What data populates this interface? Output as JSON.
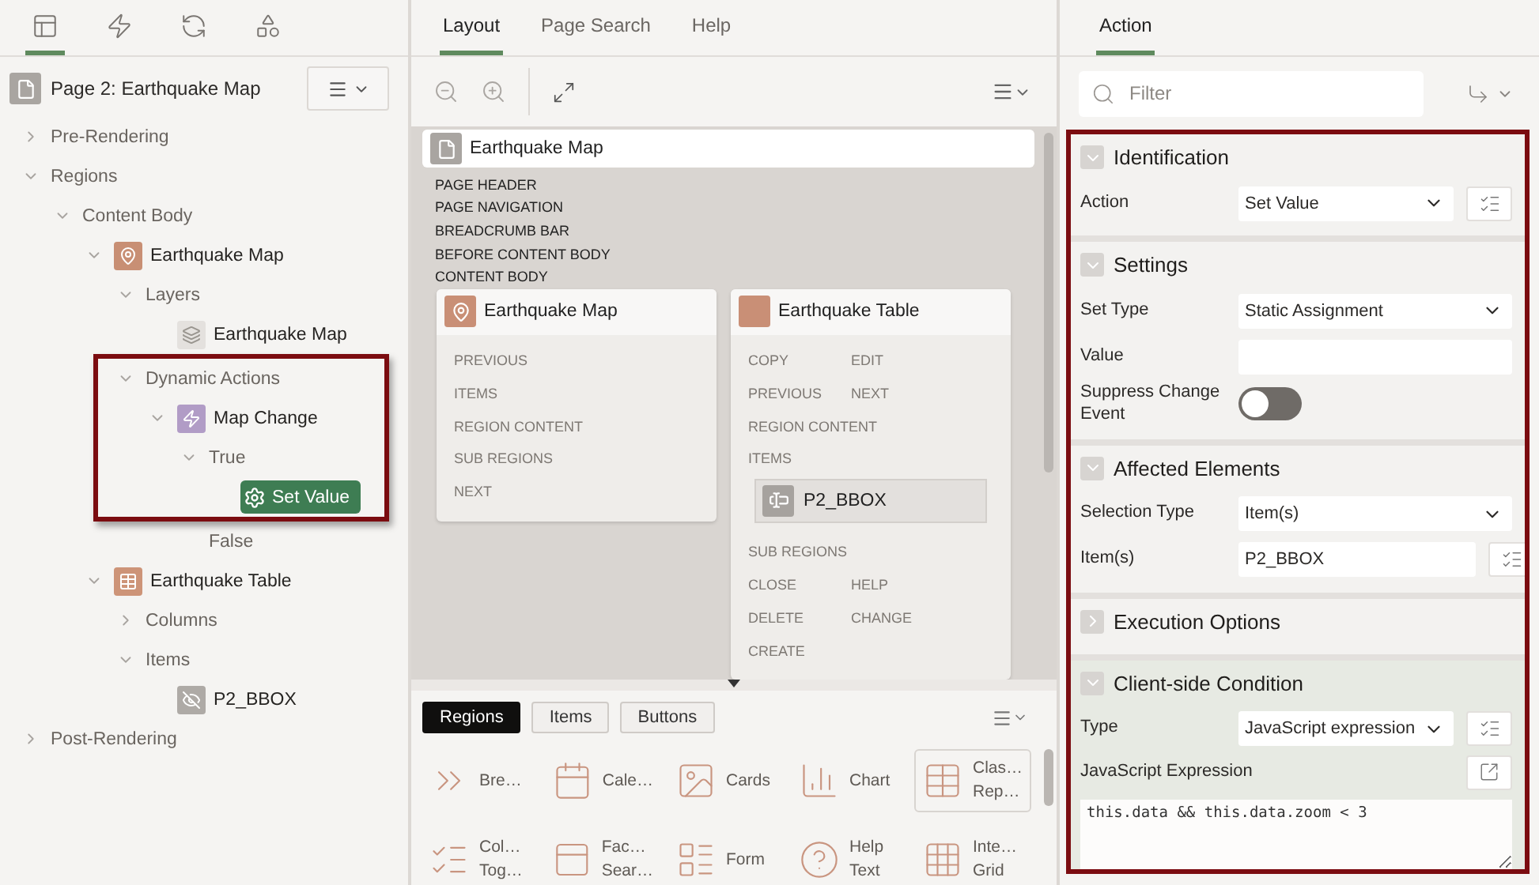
{
  "navigator": {
    "tabs": [
      {
        "kind": "rendering",
        "selected": true
      },
      {
        "kind": "dynamic",
        "selected": false
      },
      {
        "kind": "processing",
        "selected": false
      },
      {
        "kind": "shared",
        "selected": false
      }
    ],
    "page_title": "Page 2: Earthquake Map",
    "tree": [
      {
        "label": "Pre-Rendering",
        "expanded": false,
        "selected": false,
        "framed": false
      },
      {
        "label": "Regions",
        "expanded": true,
        "selected": false,
        "framed": false,
        "children": [
          {
            "label": "Content Body",
            "expanded": true,
            "selected": false,
            "framed": false,
            "children": [
              {
                "label": "Earthquake Map",
                "kind": "map",
                "expanded": true,
                "selected": false,
                "framed": false,
                "children": [
                  {
                    "label": "Layers",
                    "expanded": true,
                    "selected": false,
                    "framed": false,
                    "children": [
                      {
                        "label": "Earthquake Map",
                        "kind": "layer",
                        "selected": false,
                        "framed": false
                      }
                    ]
                  },
                  {
                    "label": "Dynamic Actions",
                    "expanded": true,
                    "selected": false,
                    "framed": true,
                    "children": [
                      {
                        "label": "Map Change",
                        "kind": "event",
                        "expanded": true,
                        "selected": false,
                        "framed": true,
                        "children": [
                          {
                            "label": "True",
                            "expanded": true,
                            "selected": false,
                            "framed": true,
                            "children": [
                              {
                                "label": "Set Value",
                                "kind": "action",
                                "selected": true,
                                "framed": true
                              }
                            ]
                          },
                          {
                            "label": "False",
                            "selected": false,
                            "framed": false
                          }
                        ]
                      }
                    ]
                  }
                ]
              },
              {
                "label": "Earthquake Table",
                "kind": "table",
                "expanded": true,
                "selected": false,
                "framed": false,
                "children": [
                  {
                    "label": "Columns",
                    "expanded": false,
                    "selected": false,
                    "framed": false
                  },
                  {
                    "label": "Items",
                    "expanded": true,
                    "selected": false,
                    "framed": false,
                    "children": [
                      {
                        "label": "P2_BBOX",
                        "kind": "hidden",
                        "selected": false,
                        "framed": false
                      }
                    ]
                  }
                ]
              }
            ]
          }
        ]
      },
      {
        "label": "Post-Rendering",
        "expanded": false,
        "selected": false,
        "framed": false
      }
    ]
  },
  "layout": {
    "tabs": [
      {
        "label": "Layout",
        "selected": true
      },
      {
        "label": "Page Search",
        "selected": false
      },
      {
        "label": "Help",
        "selected": false
      }
    ],
    "page": {
      "title": "Earthquake Map"
    },
    "positions": [
      "PAGE HEADER",
      "PAGE NAVIGATION",
      "BREADCRUMB BAR",
      "BEFORE CONTENT BODY",
      "CONTENT BODY"
    ],
    "regions": [
      {
        "title": "Earthquake Map",
        "kind": "map",
        "slots": [
          {
            "kind": "slot",
            "labels": [
              "PREVIOUS"
            ]
          },
          {
            "kind": "slot",
            "labels": [
              "ITEMS"
            ]
          },
          {
            "kind": "slot",
            "labels": [
              "REGION CONTENT"
            ]
          },
          {
            "kind": "slot",
            "labels": [
              "SUB REGIONS"
            ]
          },
          {
            "kind": "slot",
            "labels": [
              "NEXT"
            ]
          }
        ]
      },
      {
        "title": "Earthquake Table",
        "kind": "plain",
        "slots": [
          {
            "kind": "slot",
            "labels": [
              "COPY",
              "EDIT"
            ]
          },
          {
            "kind": "slot",
            "labels": [
              "PREVIOUS",
              "NEXT"
            ]
          },
          {
            "kind": "slot",
            "labels": [
              "REGION CONTENT"
            ]
          },
          {
            "kind": "slot",
            "labels": [
              "ITEMS"
            ]
          },
          {
            "kind": "item",
            "label": "P2_BBOX"
          },
          {
            "kind": "slot",
            "labels": [
              "SUB REGIONS"
            ]
          },
          {
            "kind": "slot",
            "labels": [
              "CLOSE",
              "HELP"
            ]
          },
          {
            "kind": "slot",
            "labels": [
              "DELETE",
              "CHANGE"
            ]
          },
          {
            "kind": "slot",
            "labels": [
              "CREATE"
            ]
          }
        ]
      }
    ]
  },
  "gallery": {
    "tabs": [
      {
        "label": "Regions",
        "selected": true
      },
      {
        "label": "Items",
        "selected": false
      },
      {
        "label": "Buttons",
        "selected": false
      }
    ],
    "items": [
      {
        "kind": "breadcrumb",
        "lines": [
          "Bre…"
        ],
        "selected": false
      },
      {
        "kind": "calendar",
        "lines": [
          "Cale…"
        ],
        "selected": false
      },
      {
        "kind": "cards",
        "lines": [
          "Cards"
        ],
        "selected": false
      },
      {
        "kind": "chart",
        "lines": [
          "Chart"
        ],
        "selected": false
      },
      {
        "kind": "report",
        "lines": [
          "Clas…",
          "Rep…"
        ],
        "selected": true
      },
      {
        "kind": "toggle",
        "lines": [
          "Col…",
          "Tog…"
        ],
        "selected": false
      },
      {
        "kind": "search",
        "lines": [
          "Fac…",
          "Sear…"
        ],
        "selected": false
      },
      {
        "kind": "form",
        "lines": [
          "Form"
        ],
        "selected": false
      },
      {
        "kind": "help",
        "lines": [
          "Help",
          "Text"
        ],
        "selected": false
      },
      {
        "kind": "grid",
        "lines": [
          "Inte…",
          "Grid"
        ],
        "selected": false
      }
    ]
  },
  "property_editor": {
    "tabs": [
      {
        "label": "Action",
        "selected": true
      }
    ],
    "filter": {
      "placeholder": "Filter"
    },
    "framed": true,
    "sections": [
      {
        "title": "Identification",
        "expanded": true,
        "active": false,
        "properties": [
          {
            "kind": "select",
            "label": "Action",
            "value": "Set Value",
            "picker": true
          }
        ]
      },
      {
        "title": "Settings",
        "expanded": true,
        "active": false,
        "properties": [
          {
            "kind": "select",
            "label": "Set Type",
            "value": "Static Assignment",
            "picker": false
          },
          {
            "kind": "text",
            "label": "Value",
            "picker": false
          },
          {
            "kind": "switch",
            "label": "Suppress Change Event",
            "on": false
          }
        ]
      },
      {
        "title": "Affected Elements",
        "expanded": true,
        "active": false,
        "properties": [
          {
            "kind": "select",
            "label": "Selection Type",
            "value": "Item(s)",
            "picker": false
          },
          {
            "kind": "text",
            "label": "Item(s)",
            "value": "P2_BBOX",
            "picker": true
          }
        ]
      },
      {
        "title": "Execution Options",
        "expanded": false,
        "active": false
      },
      {
        "title": "Client-side Condition",
        "expanded": true,
        "active": true,
        "properties": [
          {
            "kind": "select",
            "label": "Type",
            "value": "JavaScript expression",
            "picker": true
          },
          {
            "kind": "code",
            "label": "JavaScript Expression",
            "value": "this.data && this.data.zoom < 3"
          }
        ]
      }
    ]
  }
}
